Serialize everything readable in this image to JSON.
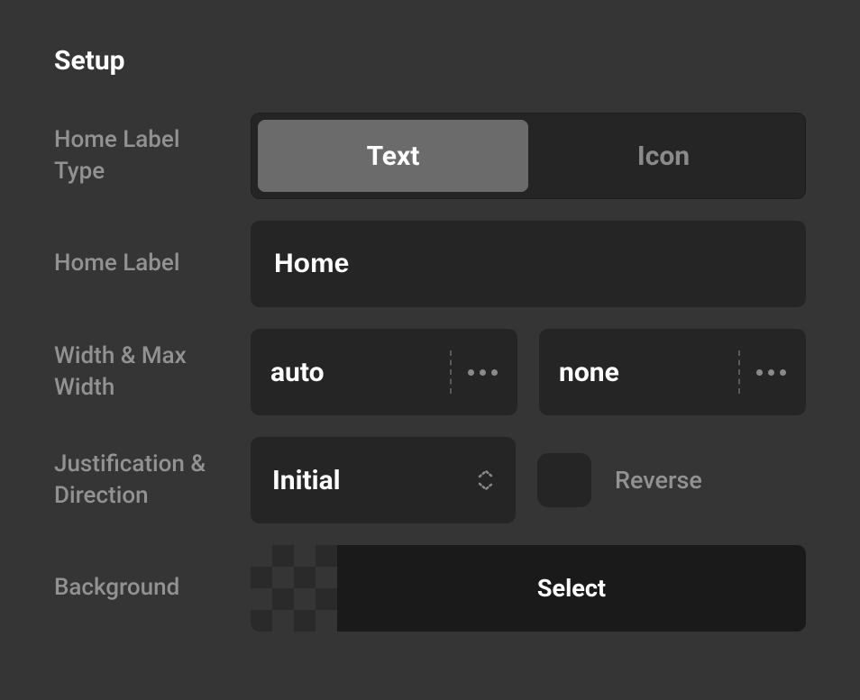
{
  "panel": {
    "title": "Setup"
  },
  "labels": {
    "home_label_type": "Home Label Type",
    "home_label": "Home Label",
    "width_max_width": "Width & Max Width",
    "justification_direction": "Justification & Direction",
    "background": "Background"
  },
  "home_label_type": {
    "options": [
      "Text",
      "Icon"
    ],
    "selected": "Text"
  },
  "home_label": {
    "value": "Home"
  },
  "width": {
    "value": "auto"
  },
  "max_width": {
    "value": "none"
  },
  "justification": {
    "value": "Initial"
  },
  "direction": {
    "reverse_label": "Reverse",
    "reverse_checked": false
  },
  "background": {
    "select_label": "Select"
  }
}
